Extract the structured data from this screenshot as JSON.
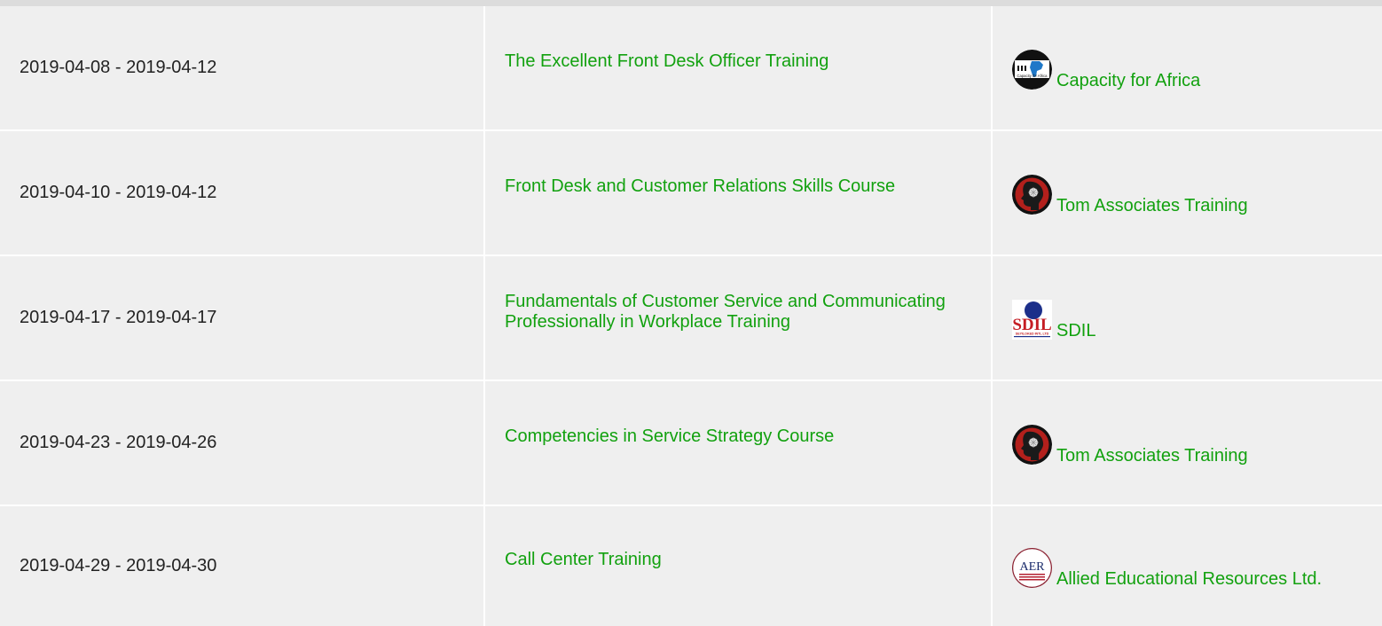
{
  "rows": [
    {
      "date": "2019-04-08 - 2019-04-12",
      "course": "The Excellent Front Desk Officer Training",
      "provider": "Capacity for Africa",
      "logo": "capacity-for-africa-logo",
      "logo_text": "Capacity for Africa"
    },
    {
      "date": "2019-04-10 - 2019-04-12",
      "course": "Front Desk and Customer Relations Skills Course",
      "provider": "Tom Associates Training",
      "logo": "tom-associates-logo"
    },
    {
      "date": "2019-04-17 - 2019-04-17",
      "course": "Fundamentals of Customer Service and Communicating Professionally in Workplace Training",
      "provider": "SDIL",
      "logo": "sdil-logo",
      "logo_text": "SDIL",
      "logo_subtext": "SEYILOKED INTL LTD"
    },
    {
      "date": "2019-04-23 - 2019-04-26",
      "course": "Competencies in Service Strategy Course",
      "provider": "Tom Associates Training",
      "logo": "tom-associates-logo"
    },
    {
      "date": "2019-04-29 - 2019-04-30",
      "course": "Call Center Training",
      "provider": "Allied Educational Resources Ltd.",
      "logo": "aer-logo",
      "logo_text": "AER"
    }
  ],
  "colors": {
    "link": "#12a10f",
    "cell_bg": "#efefef",
    "text": "#222222"
  }
}
